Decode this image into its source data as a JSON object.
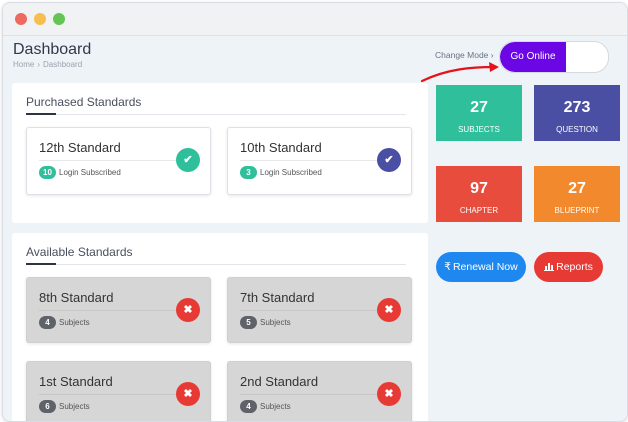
{
  "header": {
    "title": "Dashboard",
    "breadcrumb": [
      "Home",
      "Dashboard"
    ],
    "breadcrumb_separator": "›",
    "change_mode_label": "Change Mode ›",
    "toggle_label": "Go Online"
  },
  "purchased": {
    "title": "Purchased Standards",
    "cards": [
      {
        "name": "12th Standard",
        "count": "10",
        "meta": "Login Subscribed",
        "badge_icon": "check-icon",
        "color": "#2fbf9a"
      },
      {
        "name": "10th Standard",
        "count": "3",
        "meta": "Login Subscribed",
        "badge_icon": "check-icon",
        "color": "#4a4fa3"
      }
    ]
  },
  "available": {
    "title": "Available Standards",
    "cards": [
      {
        "name": "8th Standard",
        "count": "4",
        "meta": "Subjects",
        "badge_icon": "close-icon"
      },
      {
        "name": "7th Standard",
        "count": "5",
        "meta": "Subjects",
        "badge_icon": "close-icon"
      },
      {
        "name": "1st Standard",
        "count": "6",
        "meta": "Subjects",
        "badge_icon": "close-icon"
      },
      {
        "name": "2nd Standard",
        "count": "4",
        "meta": "Subjects",
        "badge_icon": "close-icon"
      }
    ]
  },
  "stats": [
    {
      "value": "27",
      "label": "SUBJECTS",
      "color": "#2fbf9a"
    },
    {
      "value": "273",
      "label": "QUESTION",
      "color": "#4a4fa3"
    },
    {
      "value": "97",
      "label": "CHAPTER",
      "color": "#e84c3d"
    },
    {
      "value": "27",
      "label": "BLUEPRINT",
      "color": "#f2892d"
    }
  ],
  "actions": {
    "renewal_icon": "₹",
    "renewal_label": "Renewal Now",
    "reports_icon": "bar-chart-icon",
    "reports_label": "Reports"
  },
  "colors": {
    "accent_purple": "#6b06e4",
    "annotation_arrow": "#e3121b",
    "button_blue": "#1e88f0",
    "button_red": "#e83a35"
  }
}
